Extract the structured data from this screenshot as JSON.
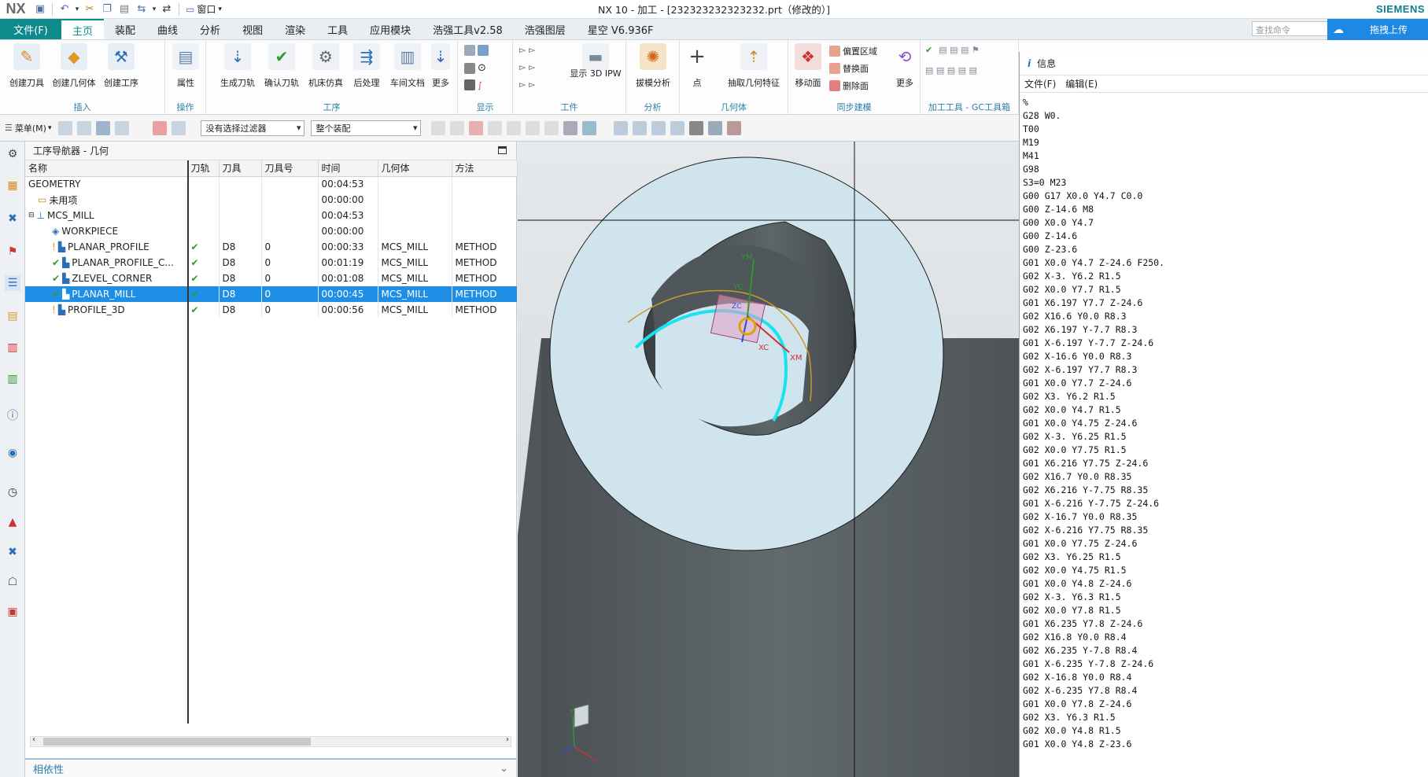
{
  "title_bar": {
    "logo": "NX",
    "window_menu": "窗口",
    "title": "NX 10 - 加工 - [232323232323232.prt（修改的）]",
    "brand": "SIEMENS"
  },
  "menu": {
    "file": "文件(F)",
    "tabs": [
      "主页",
      "装配",
      "曲线",
      "分析",
      "视图",
      "渲染",
      "工具",
      "应用模块",
      "浩强工具v2.58",
      "浩强图层",
      "星空 V6.936F"
    ],
    "active_tab": "主页",
    "search_placeholder": "查找命令",
    "upload_label": "拖拽上传"
  },
  "ribbon": {
    "groups": {
      "insert": "插入",
      "operation": "操作",
      "process": "工序",
      "display": "显示",
      "workpiece": "工件",
      "analysis": "分析",
      "geometry": "几何体",
      "sync": "同步建模",
      "gc": "加工工具 - GC工具箱"
    },
    "buttons": {
      "create_tool": "创建刀具",
      "create_geometry": "创建几何体",
      "create_operation": "创建工序",
      "properties": "属性",
      "generate_path": "生成刀轨",
      "verify_path": "确认刀轨",
      "machine_sim": "机床仿真",
      "post_process": "后处理",
      "shop_doc": "车间文档",
      "more1": "更多",
      "show_3d_ipw": "显示 3D IPW",
      "draft_analysis": "拔模分析",
      "point": "点",
      "extract_geom": "抽取几何特征",
      "move_face": "移动面",
      "offset_region": "偏置区域",
      "replace_face": "替换面",
      "delete_face": "删除面",
      "more2": "更多"
    }
  },
  "filter_bar": {
    "menu": "菜单(M)",
    "filter": "没有选择过滤器",
    "scope": "整个装配"
  },
  "navigator": {
    "title": "工序导航器 - 几何",
    "columns": [
      "名称",
      "刀轨",
      "刀具",
      "刀具号",
      "时间",
      "几何体",
      "方法"
    ],
    "rows": [
      {
        "name": "GEOMETRY",
        "path": "",
        "tool": "",
        "tool_no": "",
        "time": "00:04:53",
        "geom": "",
        "method": ""
      },
      {
        "name": "未用项",
        "path": "",
        "tool": "",
        "tool_no": "",
        "time": "00:00:00",
        "geom": "",
        "method": ""
      },
      {
        "name": "MCS_MILL",
        "path": "",
        "tool": "",
        "tool_no": "",
        "time": "00:04:53",
        "geom": "",
        "method": ""
      },
      {
        "name": "WORKPIECE",
        "path": "",
        "tool": "",
        "tool_no": "",
        "time": "00:00:00",
        "geom": "",
        "method": ""
      },
      {
        "name": "PLANAR_PROFILE",
        "path": "✔",
        "tool": "D8",
        "tool_no": "0",
        "time": "00:00:33",
        "geom": "MCS_MILL",
        "method": "METHOD"
      },
      {
        "name": "PLANAR_PROFILE_C...",
        "path": "✔",
        "tool": "D8",
        "tool_no": "0",
        "time": "00:01:19",
        "geom": "MCS_MILL",
        "method": "METHOD"
      },
      {
        "name": "ZLEVEL_CORNER",
        "path": "✔",
        "tool": "D8",
        "tool_no": "0",
        "time": "00:01:08",
        "geom": "MCS_MILL",
        "method": "METHOD"
      },
      {
        "name": "PLANAR_MILL",
        "path": "✔",
        "tool": "D8",
        "tool_no": "0",
        "time": "00:00:45",
        "geom": "MCS_MILL",
        "method": "METHOD"
      },
      {
        "name": "PROFILE_3D",
        "path": "✔",
        "tool": "D8",
        "tool_no": "0",
        "time": "00:00:56",
        "geom": "MCS_MILL",
        "method": "METHOD"
      }
    ],
    "selected_row": 7,
    "dependency_panel": "相依性"
  },
  "viewport": {
    "axis_labels": {
      "ym": "YM",
      "yc": "YC",
      "xc": "XC",
      "xm": "XM",
      "zc": "ZC",
      "x": "X",
      "y": "Y"
    }
  },
  "info_window": {
    "title": "信息",
    "menu": [
      "文件(F)",
      "编辑(E)"
    ],
    "lines": [
      "%",
      "G28 W0.",
      "T00",
      "M19",
      "M41",
      "G98",
      "S3=0 M23",
      "G00 G17 X0.0 Y4.7 C0.0",
      "G00 Z-14.6 M8",
      "G00 X0.0 Y4.7",
      "G00 Z-14.6",
      "G00 Z-23.6",
      "G01 X0.0 Y4.7 Z-24.6 F250.",
      "G02 X-3. Y6.2 R1.5",
      "G02 X0.0 Y7.7 R1.5",
      "G01 X6.197 Y7.7 Z-24.6",
      "G02 X16.6 Y0.0 R8.3",
      "G02 X6.197 Y-7.7 R8.3",
      "G01 X-6.197 Y-7.7 Z-24.6",
      "G02 X-16.6 Y0.0 R8.3",
      "G02 X-6.197 Y7.7 R8.3",
      "G01 X0.0 Y7.7 Z-24.6",
      "G02 X3. Y6.2 R1.5",
      "G02 X0.0 Y4.7 R1.5",
      "G01 X0.0 Y4.75 Z-24.6",
      "G02 X-3. Y6.25 R1.5",
      "G02 X0.0 Y7.75 R1.5",
      "G01 X6.216 Y7.75 Z-24.6",
      "G02 X16.7 Y0.0 R8.35",
      "G02 X6.216 Y-7.75 R8.35",
      "G01 X-6.216 Y-7.75 Z-24.6",
      "G02 X-16.7 Y0.0 R8.35",
      "G02 X-6.216 Y7.75 R8.35",
      "G01 X0.0 Y7.75 Z-24.6",
      "G02 X3. Y6.25 R1.5",
      "G02 X0.0 Y4.75 R1.5",
      "G01 X0.0 Y4.8 Z-24.6",
      "G02 X-3. Y6.3 R1.5",
      "G02 X0.0 Y7.8 R1.5",
      "G01 X6.235 Y7.8 Z-24.6",
      "G02 X16.8 Y0.0 R8.4",
      "G02 X6.235 Y-7.8 R8.4",
      "G01 X-6.235 Y-7.8 Z-24.6",
      "G02 X-16.8 Y0.0 R8.4",
      "G02 X-6.235 Y7.8 R8.4",
      "G01 X0.0 Y7.8 Z-24.6",
      "G02 X3. Y6.3 R1.5",
      "G02 X0.0 Y4.8 R1.5",
      "G01 X0.0 Y4.8 Z-23.6"
    ]
  },
  "colors": {
    "accent": "#0f8a8c",
    "selection": "#1f8fe6",
    "group_label": "#2a7fa8",
    "model_face": "#cfe4ec",
    "model_side": "#5b6266",
    "toolpath": "#19e3ef"
  }
}
